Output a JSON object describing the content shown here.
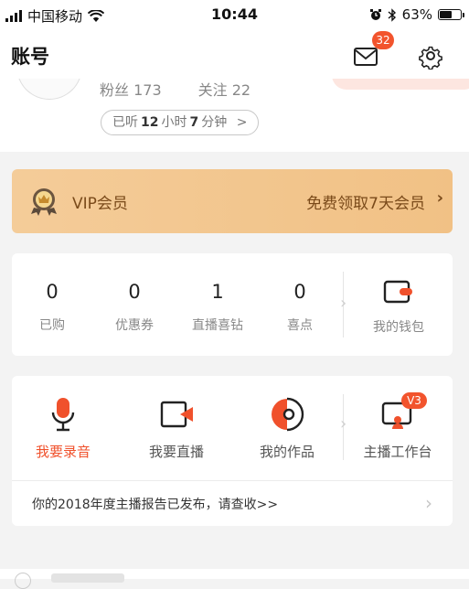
{
  "status_bar": {
    "carrier": "中国移动",
    "time": "10:44",
    "battery": "63%",
    "battery_level": 0.63
  },
  "nav": {
    "title": "账号",
    "mail_badge": "32"
  },
  "profile": {
    "fans": "粉丝 173",
    "following": "关注 22",
    "listen_prefix": "已听",
    "listen_hours": "12",
    "listen_hours_unit": "小时",
    "listen_minutes": "7",
    "listen_minutes_unit": "分钟",
    "listen_chevron": ">"
  },
  "vip": {
    "label": "VIP会员",
    "cta": "免费领取7天会员",
    "chevron": "›"
  },
  "assets": {
    "items": [
      {
        "value": "0",
        "label": "已购"
      },
      {
        "value": "0",
        "label": "优惠券"
      },
      {
        "value": "1",
        "label": "直播喜钻"
      },
      {
        "value": "0",
        "label": "喜点"
      }
    ],
    "wallet_label": "我的钱包"
  },
  "tools": {
    "items": [
      {
        "label": "我要录音",
        "icon": "microphone-icon"
      },
      {
        "label": "我要直播",
        "icon": "live-camera-icon"
      },
      {
        "label": "我的作品",
        "icon": "music-disc-icon"
      }
    ],
    "studio_label": "主播工作台",
    "studio_badge": "V3",
    "report": "你的2018年度主播报告已发布，请查收>>",
    "report_chevron": "›"
  },
  "colors": {
    "accent": "#f0512c",
    "vip_gold": "#f4cc99",
    "vip_text": "#7a4a1a"
  }
}
